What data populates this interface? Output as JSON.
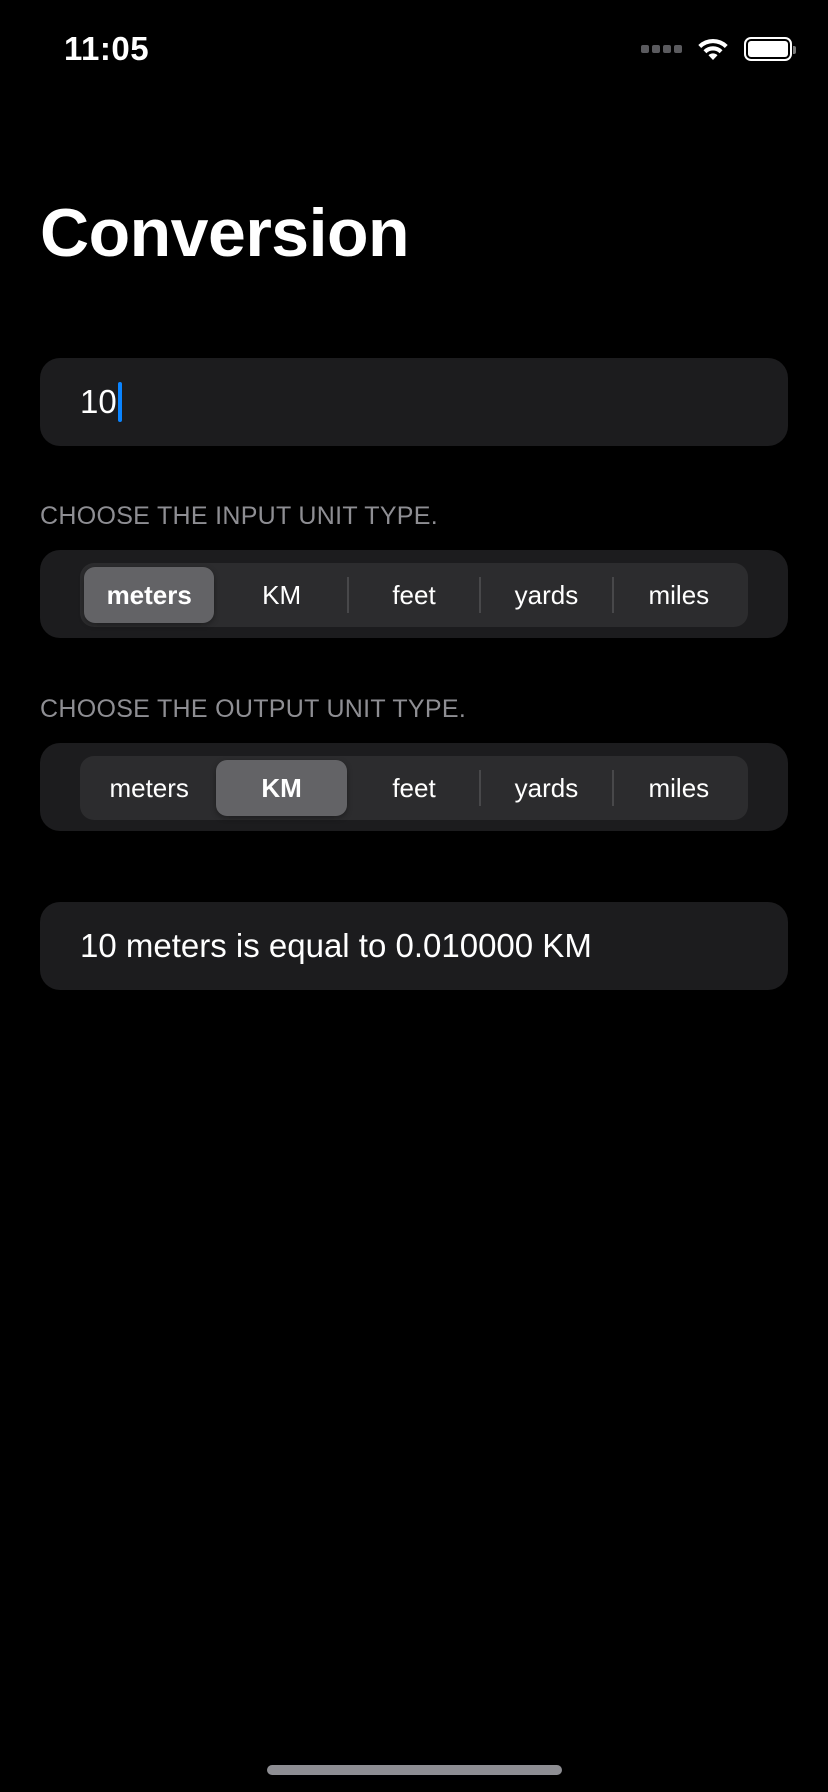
{
  "status_bar": {
    "time": "11:05",
    "icons": [
      "signal-dots-icon",
      "wifi-icon",
      "battery-icon"
    ]
  },
  "page": {
    "title": "Conversion"
  },
  "input": {
    "value": "10"
  },
  "input_unit": {
    "label": "CHOOSE THE INPUT UNIT TYPE.",
    "options": [
      "meters",
      "KM",
      "feet",
      "yards",
      "miles"
    ],
    "selected": "meters"
  },
  "output_unit": {
    "label": "CHOOSE THE OUTPUT UNIT TYPE.",
    "options": [
      "meters",
      "KM",
      "feet",
      "yards",
      "miles"
    ],
    "selected": "KM"
  },
  "result": {
    "text": "10 meters is equal to 0.010000 KM"
  },
  "colors": {
    "background": "#000000",
    "card": "#1c1c1e",
    "segment_track": "#2c2c2e",
    "segment_selected": "#636366",
    "label_gray": "#8e8e93",
    "caret": "#0a84ff"
  }
}
